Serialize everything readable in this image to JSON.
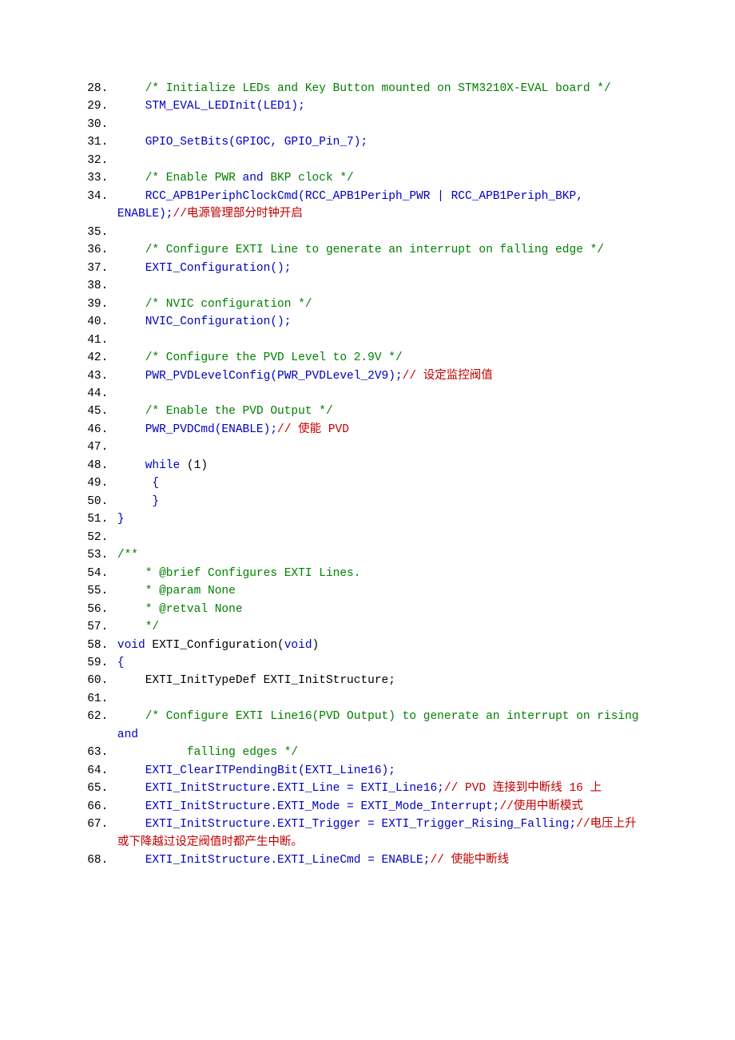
{
  "start": 28,
  "segments": [
    [
      [
        "b",
        "    "
      ],
      [
        "g",
        "/* Initialize LEDs and Key Button mounted on STM3210X-EVAL board */"
      ]
    ],
    [
      [
        "b",
        "    STM_EVAL_LEDInit(LED1);"
      ]
    ],
    [
      [
        "b",
        "    "
      ]
    ],
    [
      [
        "b",
        "    GPIO_SetBits(GPIOC, GPIO_Pin_7);"
      ]
    ],
    [
      [
        "b",
        "    "
      ]
    ],
    [
      [
        "b",
        "    "
      ],
      [
        "g",
        "/* Enable PWR "
      ],
      [
        "b",
        "and"
      ],
      [
        "g",
        " BKP clock */"
      ]
    ],
    [
      [
        "b",
        "    RCC_APB1PeriphClockCmd(RCC_APB1Periph_PWR | RCC_APB1Periph_BKP, ENABLE);"
      ],
      [
        "r",
        "//电源管理部分时钟开启"
      ]
    ],
    [
      [
        "b",
        "    "
      ]
    ],
    [
      [
        "b",
        "    "
      ],
      [
        "g",
        "/* Configure EXTI Line to generate an interrupt on falling edge */"
      ]
    ],
    [
      [
        "b",
        "    EXTI_Configuration();"
      ]
    ],
    [
      [
        "b",
        "    "
      ]
    ],
    [
      [
        "b",
        "    "
      ],
      [
        "g",
        "/* NVIC configuration */"
      ]
    ],
    [
      [
        "b",
        "    NVIC_Configuration();"
      ]
    ],
    [
      [
        "b",
        "    "
      ]
    ],
    [
      [
        "b",
        "    "
      ],
      [
        "g",
        "/* Configure the PVD Level to 2.9V */"
      ]
    ],
    [
      [
        "b",
        "    PWR_PVDLevelConfig(PWR_PVDLevel_2V9);"
      ],
      [
        "r",
        "// 设定监控阀值"
      ]
    ],
    [
      [
        "b",
        "    "
      ]
    ],
    [
      [
        "b",
        "    "
      ],
      [
        "g",
        "/* Enable the PVD Output */"
      ]
    ],
    [
      [
        "b",
        "    PWR_PVDCmd(ENABLE);"
      ],
      [
        "r",
        "// 使能 PVD"
      ]
    ],
    [
      [
        "b",
        "    "
      ]
    ],
    [
      [
        "b",
        "    while "
      ],
      [
        "k",
        "(1)"
      ]
    ],
    [
      [
        "b",
        "     {"
      ]
    ],
    [
      [
        "b",
        "     }"
      ]
    ],
    [
      [
        "b",
        "} "
      ]
    ],
    [
      [
        "b",
        "  "
      ]
    ],
    [
      [
        "g",
        "/**  "
      ]
    ],
    [
      [
        "g",
        "    * @brief Configures EXTI Lines. "
      ]
    ],
    [
      [
        "g",
        "    * @param None "
      ]
    ],
    [
      [
        "g",
        "    * @retval None "
      ]
    ],
    [
      [
        "g",
        "    */"
      ]
    ],
    [
      [
        "b",
        "void "
      ],
      [
        "k",
        "EXTI_Configuration("
      ],
      [
        "b",
        "void"
      ],
      [
        "k",
        ")"
      ]
    ],
    [
      [
        "b",
        "{"
      ]
    ],
    [
      [
        "b",
        "    "
      ],
      [
        "k",
        "EXTI_InitTypeDef EXTI_InitStructure;"
      ]
    ],
    [
      [
        "b",
        "    "
      ]
    ],
    [
      [
        "b",
        "    "
      ],
      [
        "g",
        "/* Configure EXTI Line16(PVD Output) to generate an interrupt on rising "
      ],
      [
        "b",
        "and"
      ]
    ],
    [
      [
        "g",
        "          falling edges */"
      ]
    ],
    [
      [
        "b",
        "    EXTI_ClearITPendingBit(EXTI_Line16);"
      ]
    ],
    [
      [
        "b",
        "    EXTI_InitStructure.EXTI_Line = EXTI_Line16;"
      ],
      [
        "r",
        "// PVD 连接到中断线 16 上"
      ]
    ],
    [
      [
        "b",
        "    EXTI_InitStructure.EXTI_Mode = EXTI_Mode_Interrupt;"
      ],
      [
        "r",
        "//使用中断模式"
      ]
    ],
    [
      [
        "b",
        "    EXTI_InitStructure.EXTI_Trigger = EXTI_Trigger_Rising_Falling;"
      ],
      [
        "r",
        "//电压上升或下降越过设定阀值时都产生中断。"
      ]
    ],
    [
      [
        "b",
        "    EXTI_InitStructure.EXTI_LineCmd = ENABLE;"
      ],
      [
        "r",
        "// 使能中断线"
      ]
    ]
  ]
}
